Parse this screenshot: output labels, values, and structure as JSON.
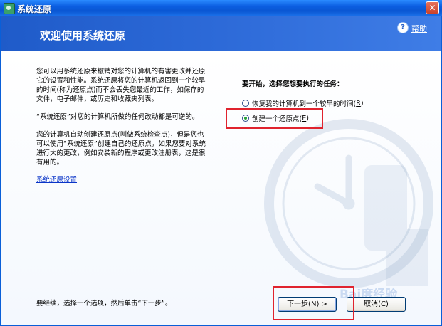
{
  "window": {
    "title": "系统还原",
    "close_glyph": "✕"
  },
  "header": {
    "title": "欢迎使用系统还原",
    "help_glyph": "?",
    "help_label": "帮助"
  },
  "left": {
    "paragraphs": [
      "您可以用系统还原来撤销对您的计算机的有害更改并还原它的设置和性能。系统还原将您的计算机返回到一个较早的时间(称为还原点)而不会丢失您最近的工作，如保存的文件，电子邮件，或历史和收藏夹列表。",
      "“系统还原”对您的计算机所做的任何改动都是可逆的。",
      "您的计算机自动创建还原点(叫做系统检查点)，但是您也可以使用“系统还原”创建自己的还原点。如果您要对系统进行大的更改，例如安装新的程序或更改注册表，这是很有用的。"
    ],
    "settings_link": "系统还原设置",
    "bottom_instruction": "要继续，选择一个选项，然后单击“下一步”。"
  },
  "right": {
    "task_heading": "要开始，选择您想要执行的任务：",
    "options": [
      {
        "label": "恢复我的计算机到一个较早的时间(",
        "key": "R",
        "suffix": ")",
        "checked": false
      },
      {
        "label": "创建一个还原点(",
        "key": "E",
        "suffix": ")",
        "checked": true
      }
    ]
  },
  "buttons": {
    "next_label": "下一步(",
    "next_key": "N",
    "next_suffix": ") >",
    "cancel_label": "取消(",
    "cancel_key": "C",
    "cancel_suffix": ")"
  },
  "overlay": {
    "watermark": "Bai度经验"
  },
  "colors": {
    "highlight_box": "#e0232e",
    "header_blue": "#2d6ad8",
    "link_blue": "#0a35c8"
  }
}
